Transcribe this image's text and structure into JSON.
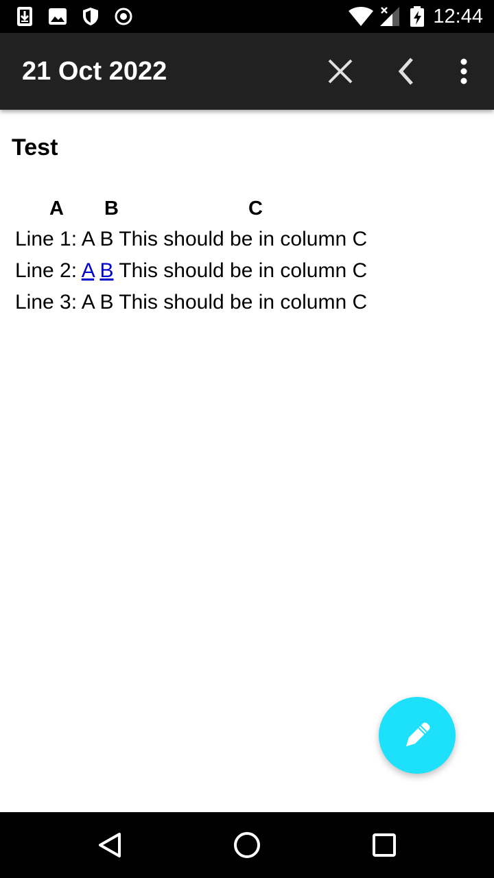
{
  "status_bar": {
    "time": "12:44",
    "left_icons": [
      "download-icon",
      "image-icon",
      "shield-icon",
      "record-icon"
    ],
    "right_icons": [
      "wifi-icon",
      "signal-icon",
      "battery-charging-icon"
    ]
  },
  "app_bar": {
    "title": "21 Oct 2022",
    "actions": [
      "close-icon",
      "back-chevron-icon",
      "more-vert-icon"
    ]
  },
  "note": {
    "title": "Test",
    "columns": [
      "A",
      "B",
      "C"
    ],
    "lines": [
      {
        "prefix": "Line 1: ",
        "a": "A",
        "b": "B",
        "c": "This should be in column C"
      },
      {
        "prefix": "Line 2: ",
        "a": "A",
        "b": "B",
        "c": "This should be in column C"
      },
      {
        "prefix": "Line 3: ",
        "a": "A",
        "b": "B",
        "c": "This should be in column C"
      }
    ]
  },
  "fab": {
    "icon": "pencil-icon",
    "color": "#1de0fb"
  },
  "nav_bar": {
    "buttons": [
      "back-triangle-icon",
      "home-circle-icon",
      "recents-square-icon"
    ]
  }
}
